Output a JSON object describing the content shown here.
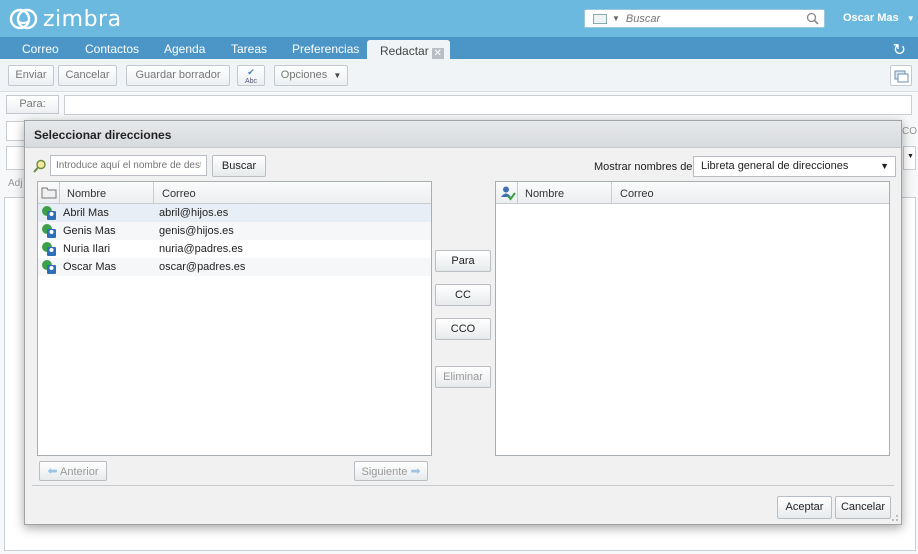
{
  "app": {
    "logo_text": "zimbra",
    "user_name": "Oscar Mas"
  },
  "search": {
    "placeholder": "Buscar"
  },
  "tabs": [
    {
      "label": "Correo"
    },
    {
      "label": "Contactos"
    },
    {
      "label": "Agenda"
    },
    {
      "label": "Tareas"
    },
    {
      "label": "Preferencias"
    }
  ],
  "active_tab": {
    "label": "Redactar"
  },
  "toolbar": {
    "send": "Enviar",
    "cancel": "Cancelar",
    "save_draft": "Guardar borrador",
    "spell": "Abc",
    "options": "Opciones"
  },
  "compose": {
    "to_label": "Para:",
    "attach_partial": "Adj",
    "cco_partial": "CO"
  },
  "dialog": {
    "title": "Seleccionar direcciones",
    "filter_placeholder": "Introduce aquí el nombre de desti",
    "search_button": "Buscar",
    "show_names_label": "Mostrar nombres de:",
    "source_selected": "Libreta general de direcciones",
    "columns": {
      "name": "Nombre",
      "email": "Correo"
    },
    "contacts": [
      {
        "name": "Abril Mas",
        "email": "abril@hijos.es"
      },
      {
        "name": "Genis Mas",
        "email": "genis@hijos.es"
      },
      {
        "name": "Nuria Ilari",
        "email": "nuria@padres.es"
      },
      {
        "name": "Oscar Mas",
        "email": "oscar@padres.es"
      }
    ],
    "buttons": {
      "to": "Para",
      "cc": "CC",
      "bcc": "CCO",
      "remove": "Eliminar",
      "previous": "Anterior",
      "next": "Siguiente",
      "accept": "Aceptar",
      "cancel": "Cancelar"
    }
  },
  "colors": {
    "header": "#6cb9df",
    "tabbar": "#4c95c7",
    "selected_row": "#e8eef5"
  }
}
